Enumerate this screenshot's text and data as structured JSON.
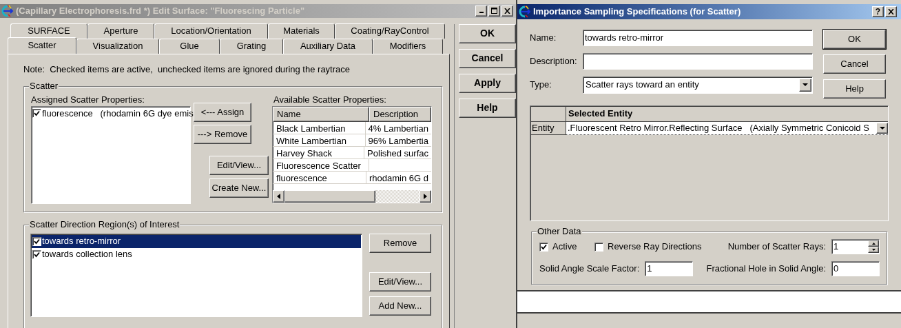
{
  "edit_surface_window": {
    "title": "(Capillary Electrophoresis.frd *) Edit Surface: \"Fluorescing Particle\"",
    "active": false,
    "tab_rows": [
      [
        {
          "label": "SURFACE",
          "selected": false
        },
        {
          "label": "Aperture",
          "selected": false
        },
        {
          "label": "Location/Orientation",
          "selected": false
        },
        {
          "label": "Materials",
          "selected": false
        },
        {
          "label": "Coating/RayControl",
          "selected": false
        }
      ],
      [
        {
          "label": "Scatter",
          "selected": true
        },
        {
          "label": "Visualization",
          "selected": false
        },
        {
          "label": "Glue",
          "selected": false
        },
        {
          "label": "Grating",
          "selected": false
        },
        {
          "label": "Auxiliary Data",
          "selected": false
        },
        {
          "label": "Modifiers",
          "selected": false
        }
      ]
    ],
    "note": "Note:  Checked items are active,  unchecked items are ignored during the raytrace",
    "scatter_group": {
      "title": "Scatter",
      "assigned_label": "Assigned Scatter Properties:",
      "assigned_items": [
        {
          "label": "fluorescence   (rhodamin 6G dye emis",
          "checked": true
        }
      ],
      "buttons": [
        "<--- Assign",
        "---> Remove",
        "Edit/View...",
        "Create New..."
      ],
      "available_label": "Available Scatter Properties:",
      "available_table": {
        "columns": [
          "Name",
          "Description"
        ],
        "rows": [
          {
            "name": "Black Lambertian",
            "description": "4% Lambertian"
          },
          {
            "name": "White Lambertian",
            "description": "96% Lambertia"
          },
          {
            "name": "Harvey Shack",
            "description": "Polished surfac"
          },
          {
            "name": "Fluorescence Scatter"
          },
          {
            "name": "fluorescence",
            "description": "rhodamin 6G d"
          }
        ]
      }
    },
    "regions_group": {
      "title": "Scatter Direction Region(s) of Interest",
      "items": [
        {
          "label": "towards retro-mirror",
          "checked": true,
          "selected": true
        },
        {
          "label": "towards collection lens",
          "checked": true,
          "selected": false
        }
      ],
      "buttons": [
        "Remove",
        "Edit/View...",
        "Add New..."
      ]
    },
    "dialog_buttons": [
      "OK",
      "Cancel",
      "Apply",
      "Help"
    ]
  },
  "importance_window": {
    "title": "Importance Sampling Specifications (for Scatter)",
    "active": true,
    "help_glyph": "?",
    "fields": [
      {
        "label": "Name:",
        "value": "towards retro-mirror",
        "kind": "text"
      },
      {
        "label": "Description:",
        "kind": "text"
      },
      {
        "label": "Type:",
        "value": "Scatter rays toward an entity",
        "kind": "dropdown"
      }
    ],
    "buttons": [
      "OK",
      "Cancel",
      "Help"
    ],
    "entity_grid": {
      "column": "Selected Entity",
      "row_header": "Entity",
      "value": ".Fluorescent Retro Mirror.Reflecting Surface   (Axially Symmetric Conicoid S"
    },
    "other_data": {
      "title": "Other Data",
      "checkboxes": [
        {
          "label": "Active",
          "checked": true
        },
        {
          "label": "Reverse Ray Directions",
          "checked": false
        }
      ],
      "scatter_rays": {
        "label": "Number of Scatter Rays:",
        "value": "1"
      },
      "solid_angle": {
        "label": "Solid Angle Scale Factor:",
        "value": "1"
      },
      "hole": {
        "label": "Fractional Hole in Solid Angle:",
        "value": "0"
      }
    }
  }
}
